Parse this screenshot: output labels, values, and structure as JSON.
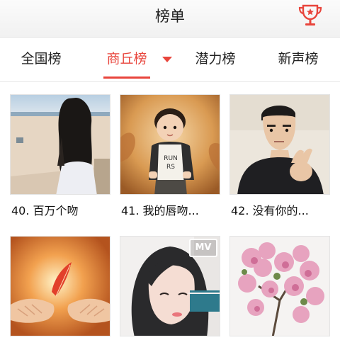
{
  "header": {
    "title": "榜单",
    "trophy_icon": "trophy-icon"
  },
  "tabs": [
    {
      "label": "全国榜",
      "active": false
    },
    {
      "label": "商丘榜",
      "active": true
    },
    {
      "label": "潜力榜",
      "active": false
    },
    {
      "label": "新声榜",
      "active": false
    }
  ],
  "colors": {
    "accent": "#e8453c"
  },
  "songs": [
    {
      "caption": "40. 百万个吻"
    },
    {
      "caption": "41. 我的唇吻..."
    },
    {
      "caption": "42. 没有你的..."
    },
    {
      "caption": ""
    },
    {
      "caption": "",
      "badge": "MV"
    },
    {
      "caption": ""
    }
  ]
}
